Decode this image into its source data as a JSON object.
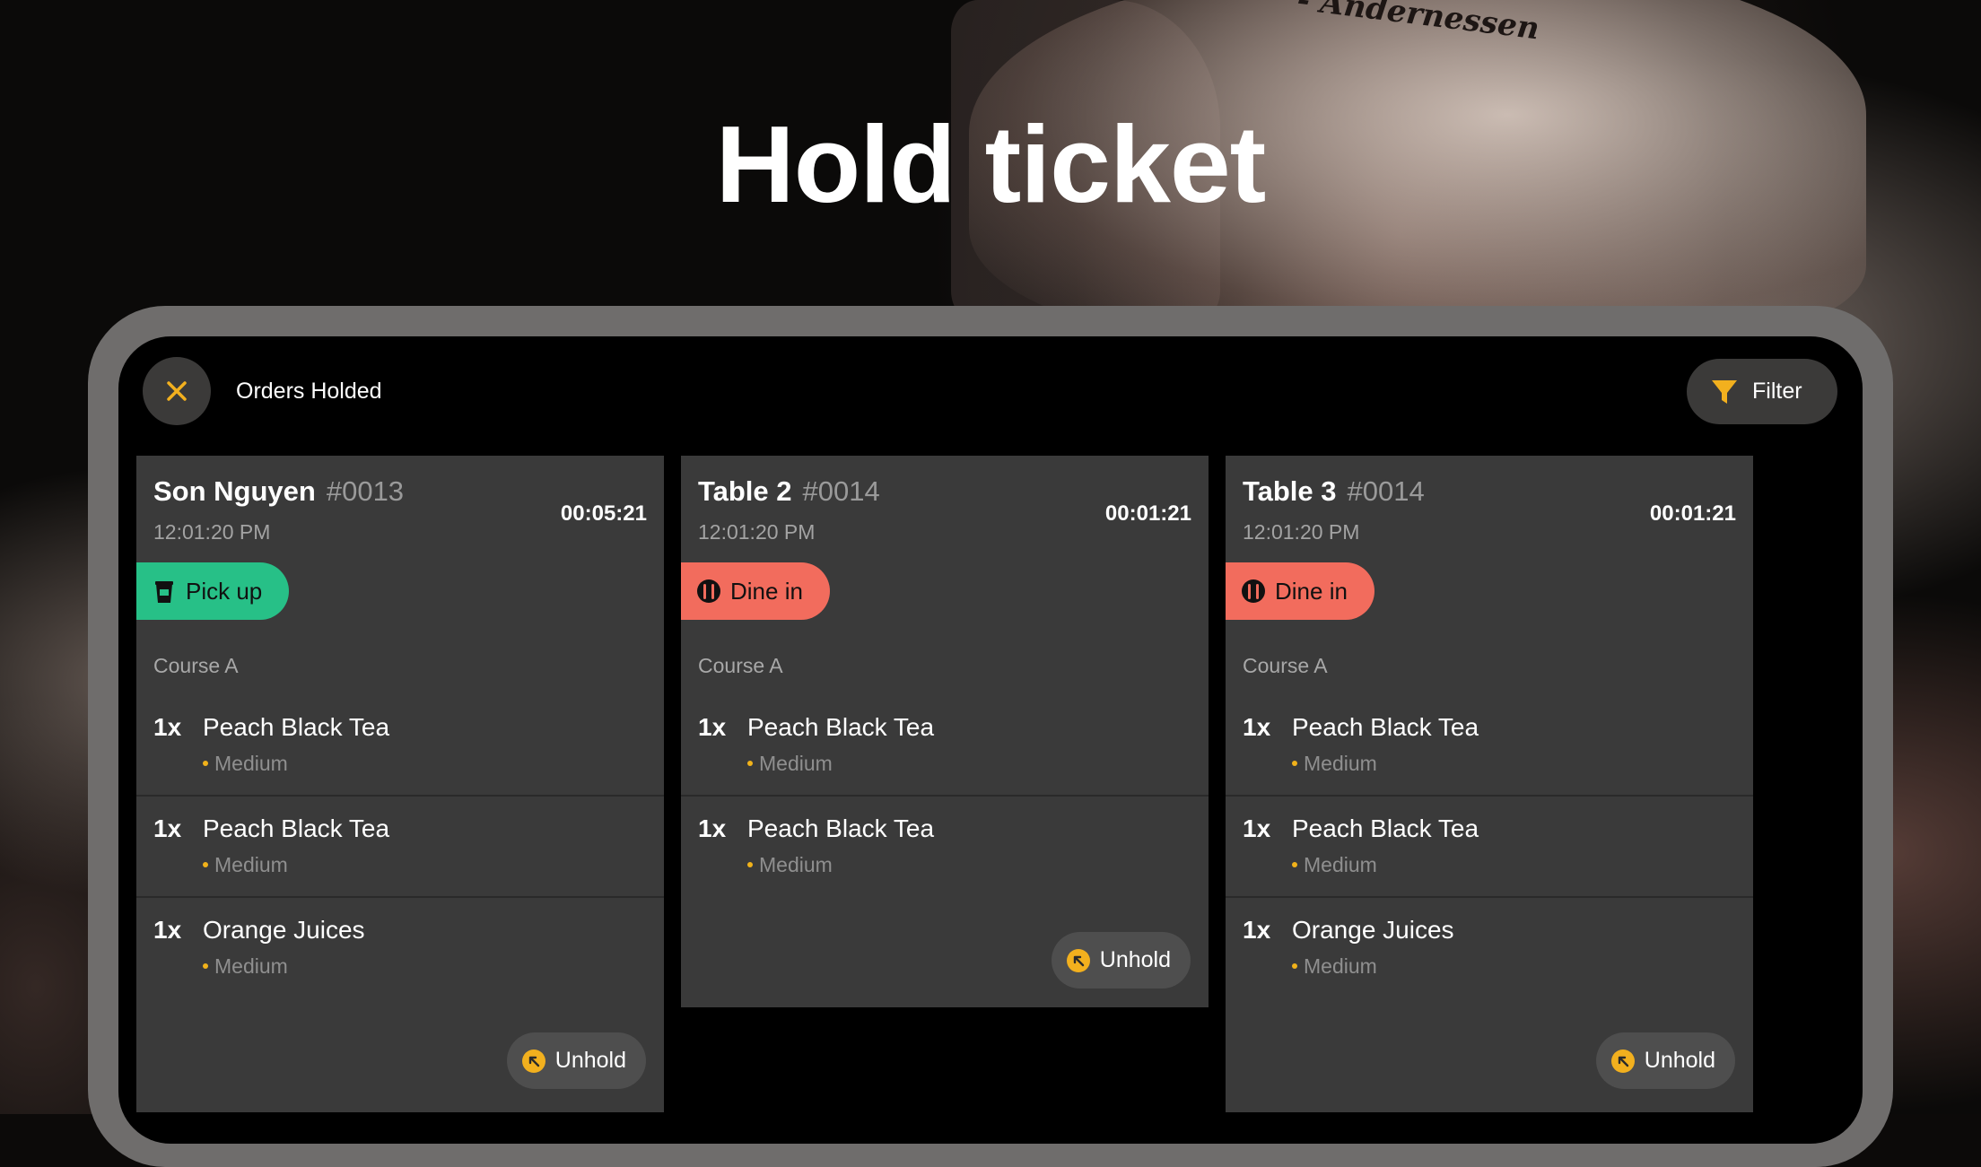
{
  "hero": {
    "title": "Hold ticket",
    "shirt_text": "- Andernessen"
  },
  "topbar": {
    "title": "Orders Holded",
    "filter_label": "Filter"
  },
  "colors": {
    "accent": "#f2b01e",
    "pickup": "#27c087",
    "dinein": "#f26c5d",
    "card": "#3a3a3a"
  },
  "orders": [
    {
      "name": "Son Nguyen",
      "number": "#0013",
      "time": "12:01:20 PM",
      "timer": "00:05:21",
      "type": "Pick up",
      "course": "Course A",
      "unhold_label": "Unhold",
      "items": [
        {
          "qty": "1x",
          "name": "Peach Black Tea",
          "modifier": "Medium"
        },
        {
          "qty": "1x",
          "name": "Peach Black Tea",
          "modifier": "Medium"
        },
        {
          "qty": "1x",
          "name": "Orange Juices",
          "modifier": "Medium"
        }
      ]
    },
    {
      "name": "Table 2",
      "number": "#0014",
      "time": "12:01:20 PM",
      "timer": "00:01:21",
      "type": "Dine in",
      "course": "Course A",
      "unhold_label": "Unhold",
      "items": [
        {
          "qty": "1x",
          "name": "Peach Black Tea",
          "modifier": "Medium"
        },
        {
          "qty": "1x",
          "name": "Peach Black Tea",
          "modifier": "Medium"
        }
      ]
    },
    {
      "name": "Table 3",
      "number": "#0014",
      "time": "12:01:20 PM",
      "timer": "00:01:21",
      "type": "Dine in",
      "course": "Course A",
      "unhold_label": "Unhold",
      "items": [
        {
          "qty": "1x",
          "name": "Peach Black Tea",
          "modifier": "Medium"
        },
        {
          "qty": "1x",
          "name": "Peach Black Tea",
          "modifier": "Medium"
        },
        {
          "qty": "1x",
          "name": "Orange Juices",
          "modifier": "Medium"
        }
      ]
    }
  ]
}
